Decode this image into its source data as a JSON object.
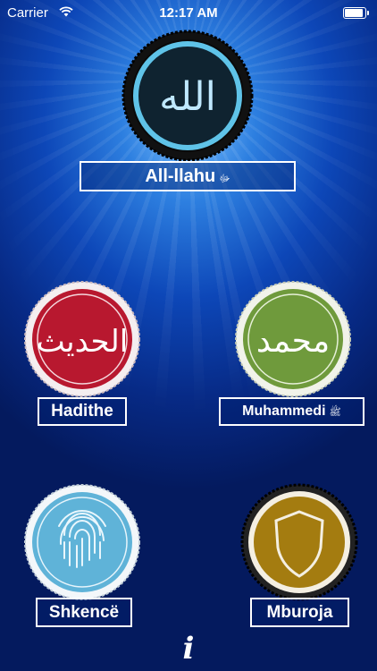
{
  "status_bar": {
    "carrier": "Carrier",
    "time": "12:17 AM",
    "battery_level": 1.0
  },
  "items": [
    {
      "label": "All-llahu",
      "honorific": "ﷻ",
      "icon": "allah-calligraphy-icon",
      "color": "#1f6f8f",
      "calligraphy": "الله"
    },
    {
      "label": "Hadithe",
      "honorific": "",
      "icon": "hadith-calligraphy-icon",
      "color": "#b8182f",
      "calligraphy": "الحديث"
    },
    {
      "label": "Muhammedi",
      "honorific": "ﷺ",
      "icon": "muhammad-calligraphy-icon",
      "color": "#6f9a3c",
      "calligraphy": "محمد"
    },
    {
      "label": "Shkencë",
      "honorific": "",
      "icon": "fingerprint-icon",
      "color": "#5fb3d8"
    },
    {
      "label": "Mburoja",
      "honorific": "",
      "icon": "shield-icon",
      "color": "#a47c10"
    }
  ],
  "info_button": {
    "label": "i",
    "icon": "info-icon"
  }
}
